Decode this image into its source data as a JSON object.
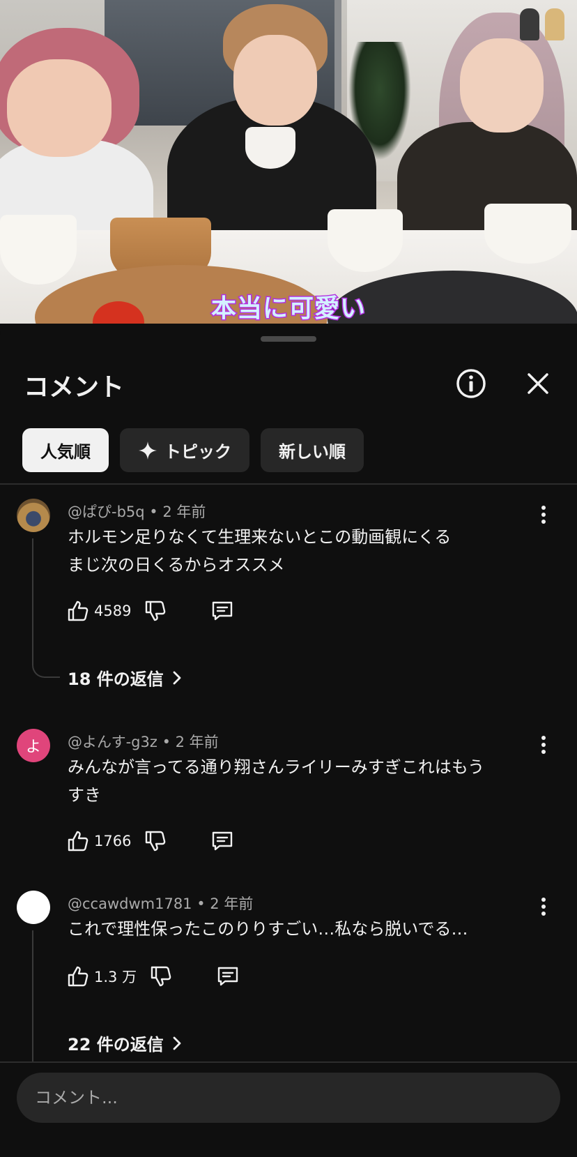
{
  "video": {
    "caption": "本当に可愛い"
  },
  "panel": {
    "title": "コメント",
    "chips": [
      {
        "label": "人気順",
        "active": true
      },
      {
        "label": "トピック",
        "active": false,
        "icon": "sparkle-icon"
      },
      {
        "label": "新しい順",
        "active": false
      }
    ]
  },
  "comments": [
    {
      "author": "@ぱぴ-b5q",
      "time": "2 年前",
      "lines": [
        "ホルモン足りなくて生理来ないとこの動画観にくる",
        "まじ次の日くるからオススメ"
      ],
      "likes": "4589",
      "replies": "18 件の返信",
      "avatar_color": "#8a6a3c"
    },
    {
      "author": "@よんす-g3z",
      "time": "2 年前",
      "lines": [
        "みんなが言ってる通り翔さんライリーみすぎこれはもう",
        "すき"
      ],
      "likes": "1766",
      "avatar_letter": "よ",
      "avatar_color": "#e0457b"
    },
    {
      "author": "@ccawdwm1781",
      "time": "2 年前",
      "lines": [
        "これで理性保ったこのりりすごい…私なら脱いでる…"
      ],
      "likes": "1.3 万",
      "replies": "22 件の返信",
      "avatar_color": "#ffffff"
    }
  ],
  "composer": {
    "placeholder": "コメント..."
  }
}
